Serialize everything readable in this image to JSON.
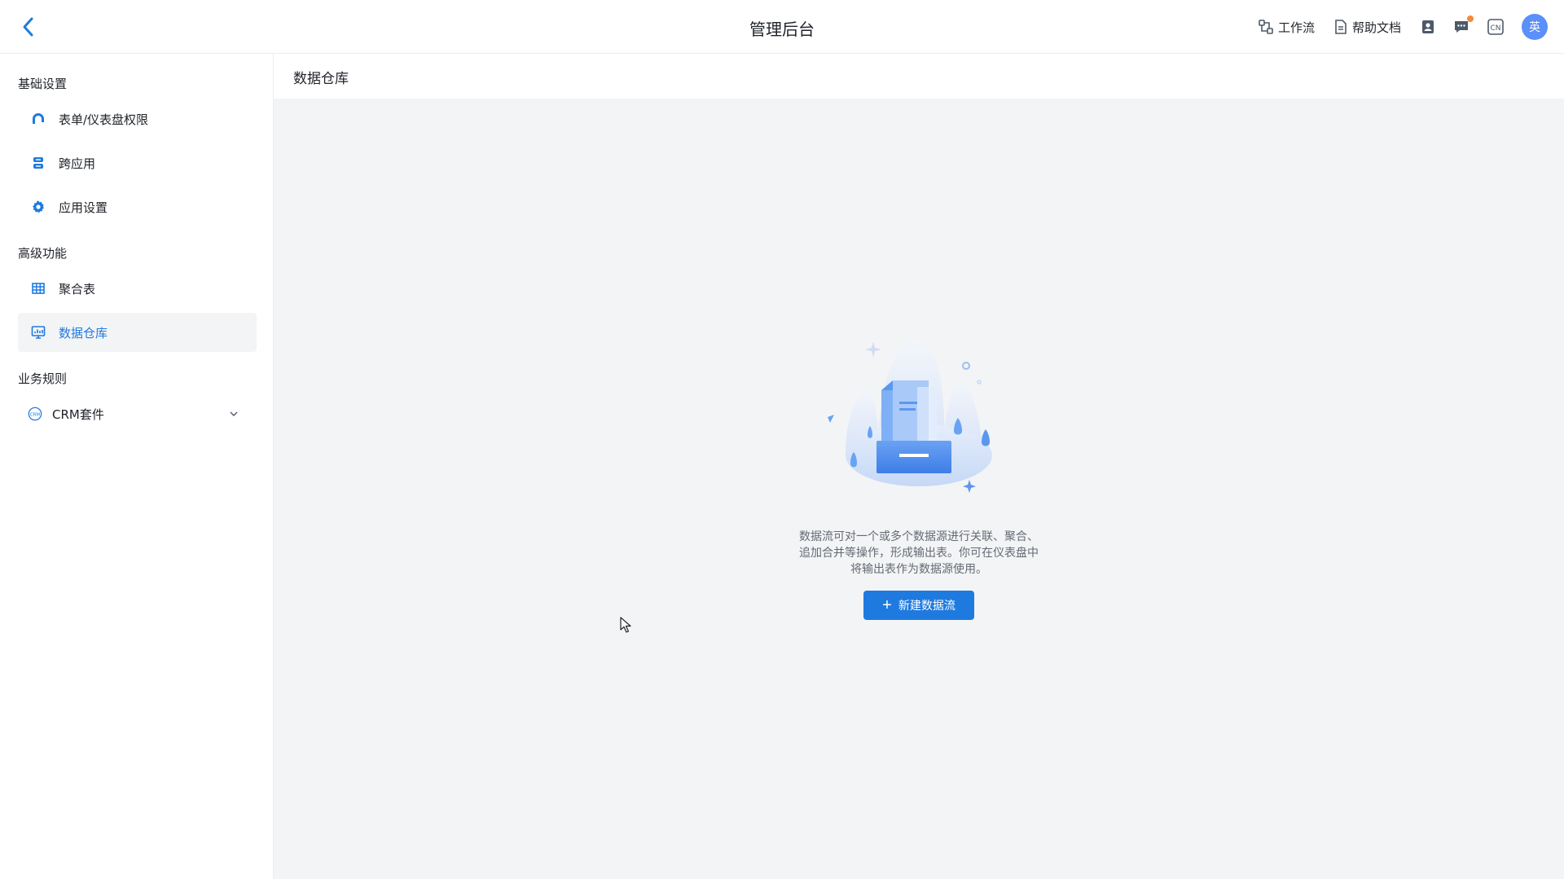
{
  "header": {
    "title": "管理后台",
    "back_icon": "chevron-left-icon",
    "links": {
      "workflow": "工作流",
      "help": "帮助文档"
    },
    "icons": [
      "contacts-icon",
      "message-icon",
      "language-icon"
    ],
    "lang_code": "CN",
    "avatar_text": "英"
  },
  "sidebar": {
    "groups": [
      {
        "title": "基础设置",
        "items": [
          {
            "label": "表单/仪表盘权限",
            "icon": "permission-icon"
          },
          {
            "label": "跨应用",
            "icon": "cross-app-icon"
          },
          {
            "label": "应用设置",
            "icon": "gear-icon"
          }
        ]
      },
      {
        "title": "高级功能",
        "items": [
          {
            "label": "聚合表",
            "icon": "table-icon"
          },
          {
            "label": "数据仓库",
            "icon": "data-warehouse-icon",
            "active": true
          }
        ]
      },
      {
        "title": "业务规则",
        "items": [
          {
            "label": "CRM套件",
            "icon": "crm-icon",
            "icon_text": "CRM",
            "expandable": true
          }
        ]
      }
    ]
  },
  "main": {
    "title": "数据仓库",
    "empty": {
      "description_lines": [
        "数据流可对一个或多个数据源进行关联、聚合、",
        "追加合并等操作，形成输出表。你可在仪表盘中",
        "将输出表作为数据源使用。"
      ],
      "button_label": "新建数据流"
    }
  },
  "colors": {
    "accent": "#1f7ae0",
    "background": "#f3f4f6",
    "notification": "#f58a3c",
    "avatar": "#5b8ff9"
  }
}
